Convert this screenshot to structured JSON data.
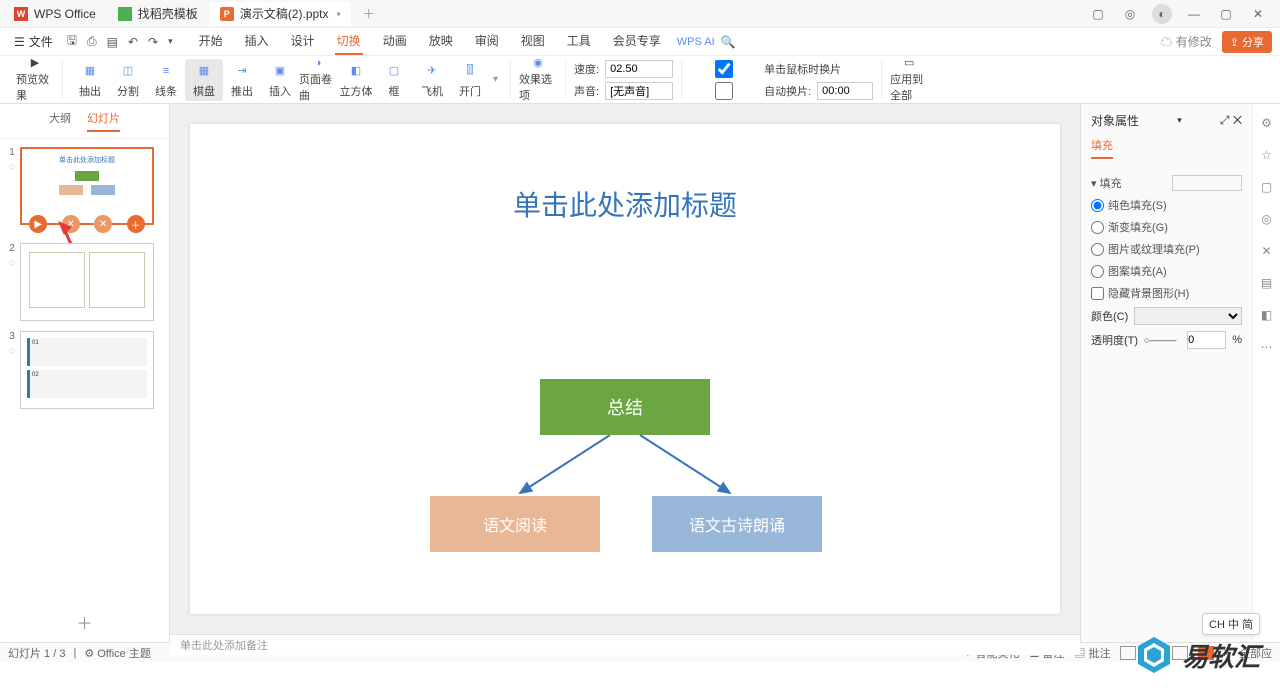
{
  "tabs": {
    "wps": "WPS Office",
    "template": "找稻壳模板",
    "file": "演示文稿(2).pptx"
  },
  "menu": {
    "file": "文件",
    "items": [
      "开始",
      "插入",
      "设计",
      "切换",
      "动画",
      "放映",
      "审阅",
      "视图",
      "工具",
      "会员专享"
    ],
    "active": "切换",
    "wpsai": "WPS AI",
    "changes": "有修改",
    "share": "分享"
  },
  "ribbon": {
    "preview": "预览效果",
    "transitions": [
      "抽出",
      "分割",
      "线条",
      "棋盘",
      "推出",
      "插入",
      "页面卷曲",
      "立方体",
      "框",
      "飞机",
      "开门"
    ],
    "selected": "棋盘",
    "options": "效果选项",
    "speed_l": "速度:",
    "speed_v": "02.50",
    "sound_l": "声音:",
    "sound_v": "[无声音]",
    "click": "单击鼠标时换片",
    "auto": "自动换片:",
    "auto_v": "00:00",
    "apply": "应用到全部"
  },
  "panel": {
    "tabs": [
      "大纲",
      "幻灯片"
    ],
    "active": "幻灯片"
  },
  "slide": {
    "title": "单击此处添加标题",
    "box1": "总结",
    "box2": "语文阅读",
    "box3": "语文古诗朗诵",
    "notes": "单击此处添加备注"
  },
  "props": {
    "title": "对象属性",
    "fill_tab": "填充",
    "fill_l": "填充",
    "solid": "纯色填充(S)",
    "gradient": "渐变填充(G)",
    "picture": "图片或纹理填充(P)",
    "pattern": "图案填充(A)",
    "hide": "隐藏背景图形(H)",
    "color": "颜色(C)",
    "trans": "透明度(T)",
    "trans_v": "0",
    "pct": "%"
  },
  "status": {
    "page": "幻灯片 1 / 3",
    "theme": "Office 主题",
    "beautify": "智能美化",
    "notes": "备注",
    "comments": "批注",
    "all": "全部应"
  },
  "ime": "CH 中 简",
  "watermark": "易软汇"
}
